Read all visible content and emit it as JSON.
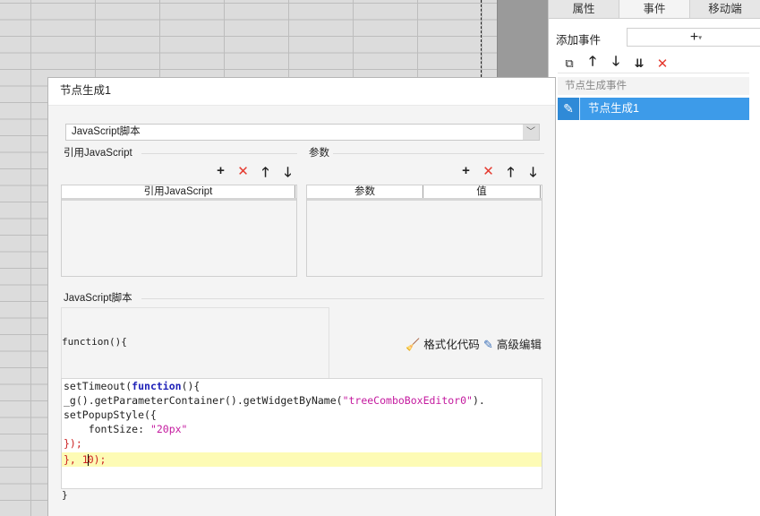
{
  "panel": {
    "tabs": [
      "属性",
      "事件",
      "移动端"
    ],
    "active_tab": "事件",
    "add_event_label": "添加事件",
    "add_event_plus": "+",
    "add_event_caret": "▾",
    "toolbar_icons": [
      "copy-icon",
      "move-up-icon",
      "move-down-icon",
      "move-bottom-icon",
      "delete-icon"
    ],
    "event_group_header": "节点生成事件",
    "event_item": "节点生成1",
    "accent": "#3d9be9"
  },
  "dialog": {
    "title": "节点生成1",
    "type_select": "JavaScript脚本",
    "ref_section_label": "引用JavaScript",
    "ref_table_header": "引用JavaScript",
    "param_section_label": "参数",
    "param_headers": [
      "参数",
      "值"
    ],
    "script_section_label": "JavaScript脚本",
    "function_header": "function(){",
    "format_code_label": "格式化代码",
    "advanced_edit_label": "高级编辑",
    "closing_brace": "}",
    "code": {
      "l1_kw": "function",
      "l1_a": "setTimeout(",
      "l1_b": "(){",
      "l2_a": "_g().getParameterContainer().getWidgetByName(",
      "l2_str": "\"treeComboBoxEditor0\"",
      "l2_b": ").",
      "l3_a": "setPopupStyle({",
      "l4_key": "    fontSize: ",
      "l4_val": "\"20px\"",
      "l5": "});",
      "l6_a": "}, 1",
      "l6_b": "0);"
    }
  }
}
